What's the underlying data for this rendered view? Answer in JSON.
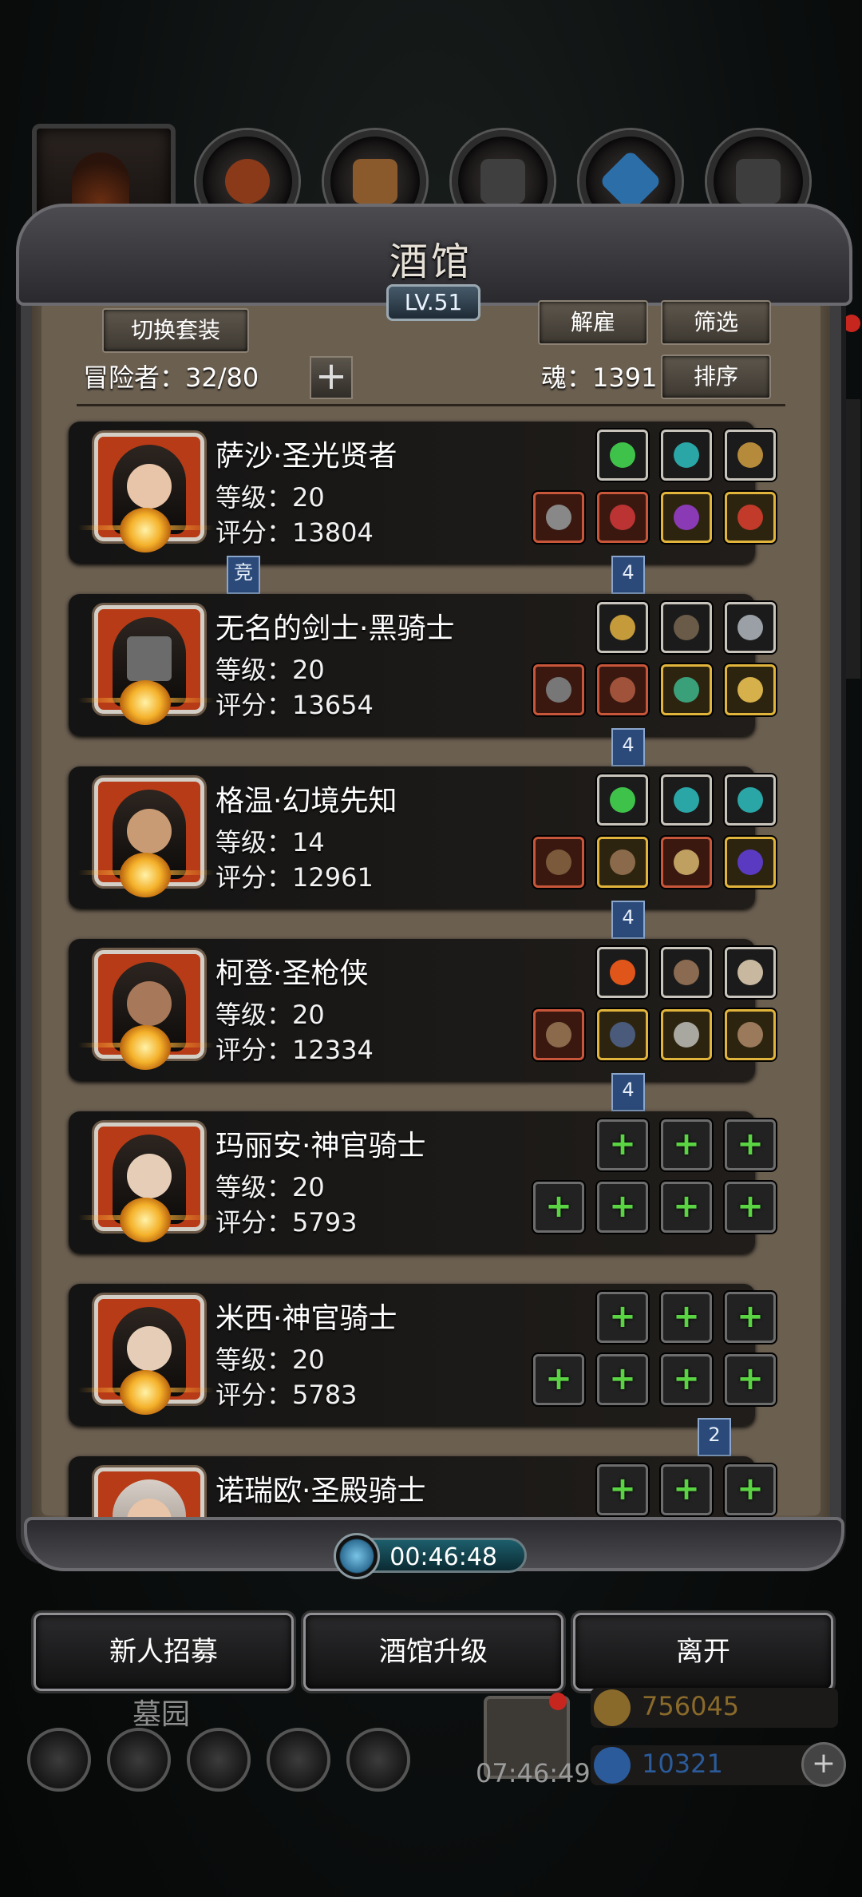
{
  "screen": {
    "title": "酒馆",
    "level": "LV.51"
  },
  "top_tabs": [
    {
      "icon": "hero-tab-icon"
    },
    {
      "icon": "shield-tab-icon",
      "color": "#8a3a18"
    },
    {
      "icon": "chest-tab-icon",
      "color": "#8a5a2c"
    },
    {
      "icon": "anvil-tab-icon",
      "color": "#444"
    },
    {
      "icon": "crystal-tab-icon",
      "color": "#2b6ea8"
    },
    {
      "icon": "cube-tab-icon",
      "color": "#444"
    }
  ],
  "controls": {
    "switch_outfit": "切换套装",
    "dismiss": "解雇",
    "filter": "筛选",
    "sort": "排序",
    "adventurers": "冒险者：32/80",
    "soul": "魂：1391",
    "add_symbol": "+"
  },
  "heroes": [
    {
      "name": "萨沙·圣光贤者",
      "level": "等级：20",
      "score": "评分：13804",
      "skin": "#e8c4a8",
      "top_slots": [
        "green-crystal-icon",
        "cyan-gem-icon",
        "gold-ornament-icon"
      ],
      "bottom_slots": [
        "axe-icon",
        "vial-icon",
        "purple-eye-icon",
        "red-gem-icon"
      ]
    },
    {
      "name": "无名的剑士·黑骑士",
      "level": "等级：20",
      "score": "评分：13654",
      "skin": "#6b6b6b",
      "top_slots": [
        "gold-mask-icon",
        "bow-icon",
        "dagger-icon"
      ],
      "bottom_slots": [
        "greatsword-icon",
        "armor-icon",
        "jade-ring-icon",
        "gold-ring-icon"
      ]
    },
    {
      "name": "格温·幻境先知",
      "level": "等级：14",
      "score": "评分：12961",
      "skin": "#c99b74",
      "top_slots": [
        "green-crystal-icon",
        "cyan-gem-icon",
        "cyan-gem-icon"
      ],
      "bottom_slots": [
        "staff-icon",
        "demon-helm-icon",
        "orb-icon",
        "purple-ring-icon"
      ]
    },
    {
      "name": "柯登·圣枪侠",
      "level": "等级：20",
      "score": "评分：12334",
      "skin": "#a8785a",
      "top_slots": [
        "fire-icon",
        "bowl-icon",
        "skull-icon"
      ],
      "bottom_slots": [
        "rifle-icon",
        "coat-icon",
        "bracelet-icon",
        "mask-icon"
      ]
    },
    {
      "name": "玛丽安·神官骑士",
      "level": "等级：20",
      "score": "评分：5793",
      "skin": "#e6cdb8",
      "top_slots": [
        "empty",
        "empty",
        "empty"
      ],
      "bottom_slots": [
        "empty",
        "empty",
        "empty",
        "empty"
      ]
    },
    {
      "name": "米西·神官骑士",
      "level": "等级：20",
      "score": "评分：5783",
      "skin": "#e6cdb8",
      "top_slots": [
        "empty",
        "empty",
        "empty"
      ],
      "bottom_slots": [
        "empty",
        "empty",
        "empty",
        "empty"
      ]
    },
    {
      "name": "诺瑞欧·圣殿骑士",
      "level": "",
      "score": "",
      "skin": "#d8d0c8",
      "top_slots": [
        "empty",
        "empty",
        "empty"
      ],
      "bottom_slots": []
    }
  ],
  "tags": {
    "arena": "竞",
    "t1": "4",
    "t2": "4",
    "t3": "4",
    "t4": "4",
    "t5": "2"
  },
  "timer": "00:46:48",
  "bottom_buttons": {
    "recruit": "新人招募",
    "upgrade": "酒馆升级",
    "leave": "离开"
  },
  "hud": {
    "location": "墓园",
    "clock": "07:46:49",
    "gold": "756045",
    "gems": "10321",
    "gold_color": "#8a6a2a",
    "gem_color": "#2b5b9a",
    "add": "+"
  }
}
